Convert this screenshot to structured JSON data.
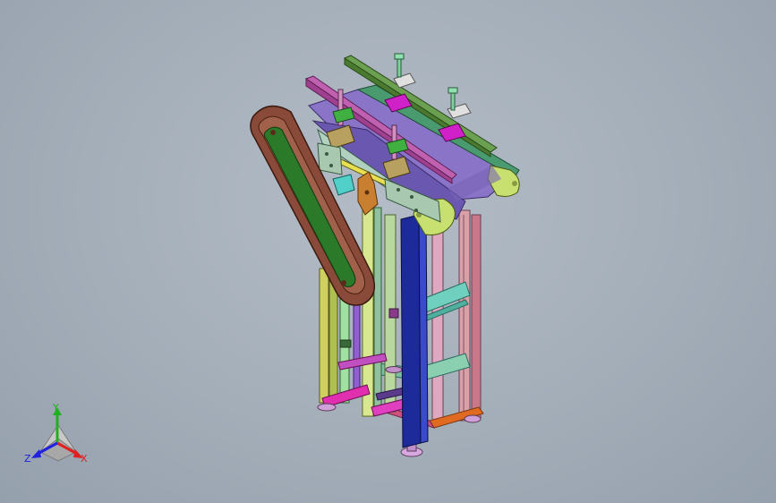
{
  "viewport": {
    "model": "conveyor-assembly",
    "colors": {
      "background": "#a4aeb9",
      "frame_pink": "#d8a0a8",
      "frame_yellow": "#c8c86a",
      "post_navy": "#1d2a9a",
      "belt_purple": "#8a74c8",
      "end_cap": "#c8e070",
      "guide_green": "#6aa050",
      "guide_pink": "#c060b0",
      "block_magenta": "#d020c8",
      "side_belt_brown": "#8a4a3a",
      "side_belt_green": "#2a7a2a",
      "cross_cyan": "#70d0c0",
      "foot": "#d0a0d8"
    }
  },
  "triad": {
    "y_label": "Y",
    "x_label": "X",
    "z_label": "Z",
    "y_color": "#20b020",
    "x_color": "#e02020",
    "z_color": "#2020e0"
  }
}
